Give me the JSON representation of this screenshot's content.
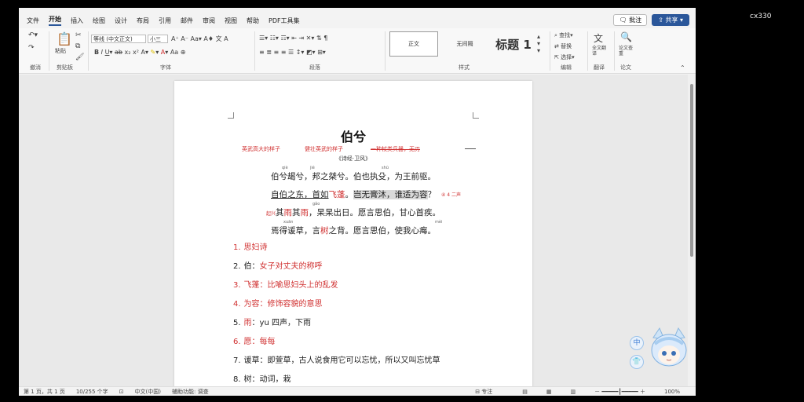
{
  "overlay": {
    "user_tag": "cx330"
  },
  "menu": [
    "文件",
    "开始",
    "插入",
    "绘图",
    "设计",
    "布局",
    "引用",
    "邮件",
    "审阅",
    "视图",
    "帮助",
    "PDF工具集"
  ],
  "menu_active_index": 1,
  "top_buttons": {
    "annotate": "批注",
    "share": "共享"
  },
  "ribbon": {
    "groups": {
      "undo": "撤消",
      "clipboard": "剪贴板",
      "font": "字体",
      "paragraph": "段落",
      "styles": "样式",
      "editing": "编辑",
      "translate": "翻译",
      "paper": "论文"
    },
    "paste_label": "粘贴",
    "font_name": "等线 (中文正文)",
    "font_size": "小三",
    "styles": [
      "正文",
      "无间隔",
      "标题 1"
    ],
    "edit_items": [
      "查找",
      "替换",
      "选择"
    ],
    "translate_label": "全文翻译",
    "paper_label": "论文查重"
  },
  "doc": {
    "title": "伯兮",
    "annotations": [
      "英武高大的样子",
      "健壮英武的样子",
      "一种杖类兵器，无刃"
    ],
    "source": "《诗经·卫风》",
    "lines": [
      {
        "pre": "伯兮朅兮，邦之桀兮。伯也执殳，为王前驱。"
      },
      {
        "a": "自伯之东，首如",
        "red": "飞蓬",
        "b": "。",
        "hl": "岂无膏沐，谁适为容",
        "c": "？"
      },
      {
        "note": "起兴",
        "a": "其",
        "red1": "雨",
        "b": "其",
        "red2": "雨",
        "c": "，杲杲出日。愿言思伯，甘心首疾。"
      },
      {
        "a": "焉得谖草，言",
        "red": "树",
        "b": "之背。愿言思伯，使我心痗。"
      }
    ],
    "side_note": "④ 4 二声",
    "notes": [
      {
        "num": "1.",
        "head": "思妇诗",
        "body": ""
      },
      {
        "num": "2.",
        "head": "伯",
        "body": "女子对丈夫的称呼"
      },
      {
        "num": "3.",
        "head": "飞蓬",
        "body": "比喻思妇头上的乱发"
      },
      {
        "num": "4.",
        "head": "为容",
        "body": "修饰容貌的意思"
      },
      {
        "num": "5.",
        "head": "雨",
        "body": "yu 四声，下雨"
      },
      {
        "num": "6.",
        "head": "愿",
        "body": "每每"
      },
      {
        "num": "7.",
        "head": "谖草",
        "body": "即萱草，古人说食用它可以忘忧，所以又叫忘忧草"
      },
      {
        "num": "8.",
        "head": "树",
        "body": "动词，栽"
      }
    ],
    "pinyin": {
      "jie": "qiè",
      "ge": "jié",
      "shu": "shū",
      "gao": "gǎo",
      "xuan": "xuān",
      "mei": "mèi"
    }
  },
  "status": {
    "page": "第 1 页，共 1 页",
    "words": "10/255 个字",
    "lang": "中文(中国)",
    "access": "辅助功能: 调查",
    "focus": "专注",
    "zoom": "100%"
  },
  "float_buttons": [
    "中",
    "👕"
  ]
}
